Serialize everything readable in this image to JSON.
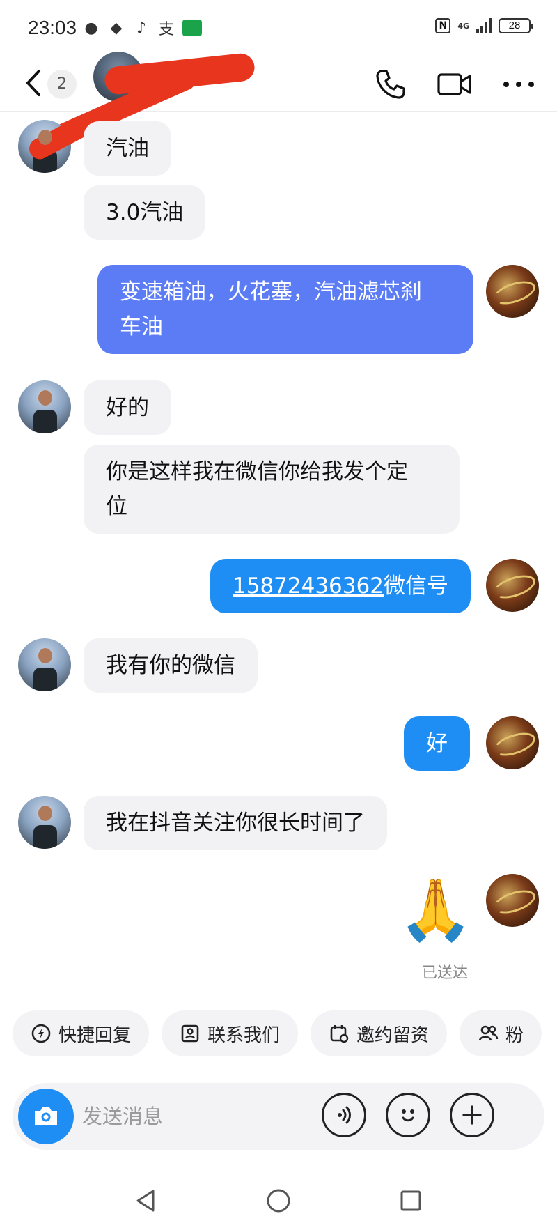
{
  "status_bar": {
    "time": "23:03",
    "network": "4G",
    "battery": "28"
  },
  "header": {
    "unread_count": "2",
    "contact_name_redacted": true
  },
  "messages": [
    {
      "side": "in",
      "text": "汽油"
    },
    {
      "side": "in",
      "text": "3.0汽油"
    },
    {
      "side": "out",
      "text_line1": "变速箱油，火花塞，汽油滤芯刹",
      "text_line2": "车油"
    },
    {
      "side": "in",
      "text": "好的"
    },
    {
      "side": "in",
      "text_line1": "你是这样我在微信你给我发个定",
      "text_line2": "位"
    },
    {
      "side": "out",
      "phone": "15872436362",
      "suffix": "微信号"
    },
    {
      "side": "in",
      "text": "我有你的微信"
    },
    {
      "side": "out",
      "text": "好"
    },
    {
      "side": "in",
      "text": "我在抖音关注你很长时间了"
    },
    {
      "side": "out",
      "emoji": "🙏",
      "status": "已送达"
    }
  ],
  "quick_replies": [
    {
      "label": "快捷回复",
      "icon": "lightning-icon"
    },
    {
      "label": "联系我们",
      "icon": "contact-card-icon"
    },
    {
      "label": "邀约留资",
      "icon": "calendar-icon"
    },
    {
      "label": "粉",
      "icon": "fans-icon"
    }
  ],
  "input": {
    "placeholder": "发送消息"
  },
  "colors": {
    "accent": "#1e8ef5",
    "outgoing_bubble": "#5b7cf4",
    "incoming_bubble": "#f2f2f4",
    "redaction": "#e8351e"
  }
}
